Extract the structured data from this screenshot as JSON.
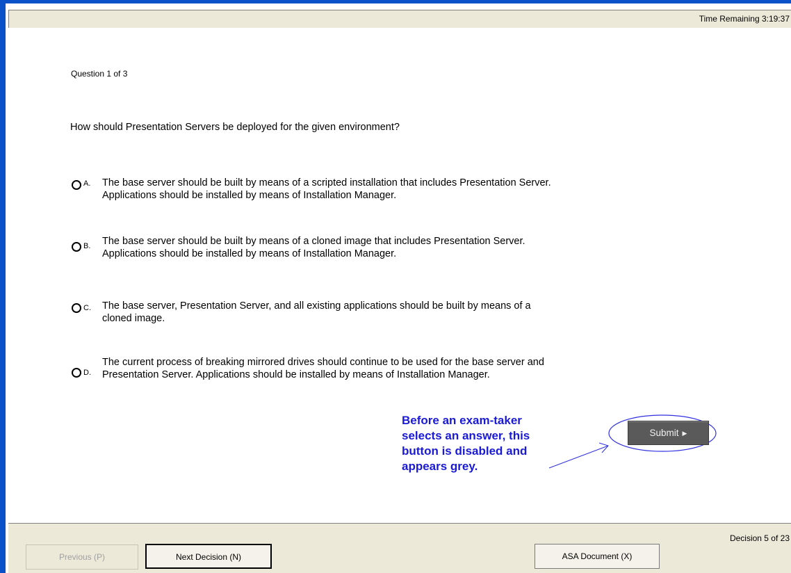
{
  "header": {
    "time_remaining": "Time Remaining 3:19:37"
  },
  "question": {
    "counter": "Question 1 of 3",
    "text": "How should Presentation Servers be deployed for the given environment?",
    "options": [
      {
        "letter": "A.",
        "text": "The base server should be built by means of a scripted installation that includes Presentation Server. Applications should be installed by means of Installation Manager."
      },
      {
        "letter": "B.",
        "text": "The base server should be built by means of a cloned image that includes Presentation Server. Applications should be installed by means of Installation Manager."
      },
      {
        "letter": "C.",
        "text": "The base server, Presentation Server, and all existing applications should be built by means of a cloned image."
      },
      {
        "letter": "D.",
        "text": "The current process of breaking mirrored drives should continue to be used for the base server and Presentation Server. Applications should be installed by means of Installation Manager."
      }
    ]
  },
  "annotation": {
    "lines": [
      "Before an exam-taker",
      "selects an answer, this",
      "button is disabled and",
      "appears grey."
    ],
    "color": "#1a1ad6"
  },
  "submit": {
    "label": "Submit",
    "state": "disabled",
    "arrow_icon": "triangle-right-icon"
  },
  "footer": {
    "decision_counter": "Decision 5 of 23",
    "previous_label": "Previous (P)",
    "next_label": "Next Decision (N)",
    "asa_label": "ASA Document (X)"
  },
  "colors": {
    "window_border": "#0a50c8",
    "toolbar_bg": "#ece9d8",
    "submit_bg": "#5a5a5a"
  }
}
